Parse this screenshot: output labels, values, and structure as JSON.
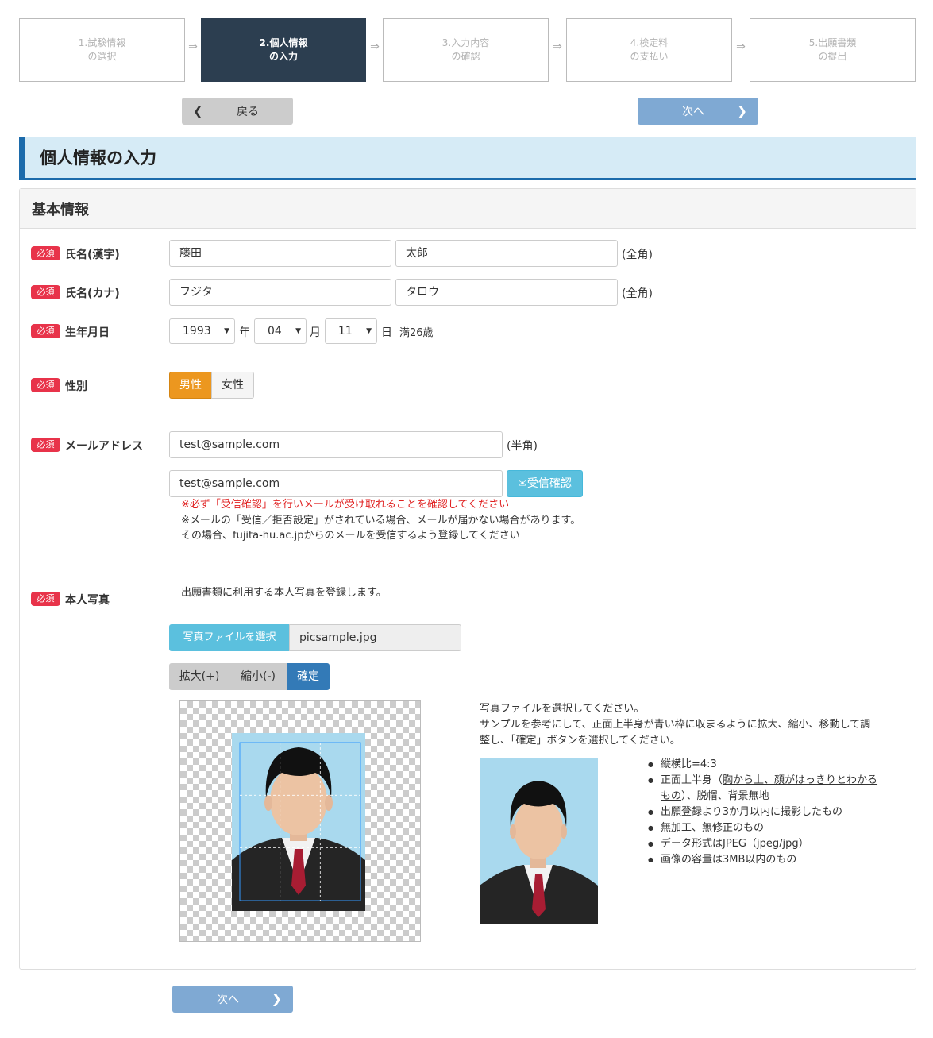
{
  "steps": [
    {
      "line1": "1.試験情報",
      "line2": "の選択"
    },
    {
      "line1": "2.個人情報",
      "line2": "の入力"
    },
    {
      "line1": "3.入力内容",
      "line2": "の確認"
    },
    {
      "line1": "4.検定料",
      "line2": "の支払い"
    },
    {
      "line1": "5.出願書類",
      "line2": "の提出"
    }
  ],
  "step_arrow": "⇒",
  "nav": {
    "back_label": "戻る",
    "next_label": "次へ"
  },
  "page_title": "個人情報の入力",
  "panel_title": "基本情報",
  "required_badge": "必須",
  "name_kanji": {
    "label": "氏名(漢字)",
    "last": "藤田",
    "first": "太郎",
    "unit": "(全角)"
  },
  "name_kana": {
    "label": "氏名(カナ)",
    "last": "フジタ",
    "first": "タロウ",
    "unit": "(全角)"
  },
  "birth": {
    "label": "生年月日",
    "year": "1993",
    "year_unit": "年",
    "month": "04",
    "month_unit": "月",
    "day": "11",
    "day_unit": "日",
    "age": "満26歳"
  },
  "gender": {
    "label": "性別",
    "male": "男性",
    "female": "女性",
    "selected": "男性"
  },
  "email": {
    "label": "メールアドレス",
    "value": "test@sample.com",
    "confirm_value": "test@sample.com",
    "unit": "(半角)",
    "recv_button": "受信確認",
    "note_red": "※必ず「受信確認」を行いメールが受け取れることを確認してください",
    "note1": "※メールの「受信／拒否設定」がされている場合、メールが届かない場合があります。",
    "note2": "その場合、fujita-hu.ac.jpからのメールを受信するよう登録してください"
  },
  "photo": {
    "label": "本人写真",
    "description": "出願書類に利用する本人写真を登録します。",
    "file_button": "写真ファイルを選択",
    "file_name": "picsample.jpg",
    "zoom_in": "拡大(+)",
    "zoom_out": "縮小(-)",
    "confirm": "確定",
    "instruction1": "写真ファイルを選択してください。",
    "instruction2": "サンプルを参考にして、正面上半身が青い枠に収まるように拡大、縮小、移動して調",
    "instruction3": "整し、「確定」ボタンを選択してください。",
    "requirements": {
      "r1": "縦横比=4:3",
      "r2_a": "正面上半身（",
      "r2_u1": "胸から上、顔がはっきりとわかる",
      "r2_u2": "もの",
      "r2_b": "）、脱帽、背景無地",
      "r3": "出願登録より3か月以内に撮影したもの",
      "r4": "無加工、無修正のもの",
      "r5": "データ形式はJPEG（jpeg/jpg）",
      "r6": "画像の容量は3MB以内のもの"
    }
  },
  "colors": {
    "active_step": "#2c3e50",
    "title_accent": "#1c6bab",
    "required": "#e8334a",
    "male_selected": "#ec971f",
    "info_button": "#5bc0de",
    "primary": "#337ab7",
    "next_button": "#7fa9d3",
    "warning_text": "#e02020"
  }
}
